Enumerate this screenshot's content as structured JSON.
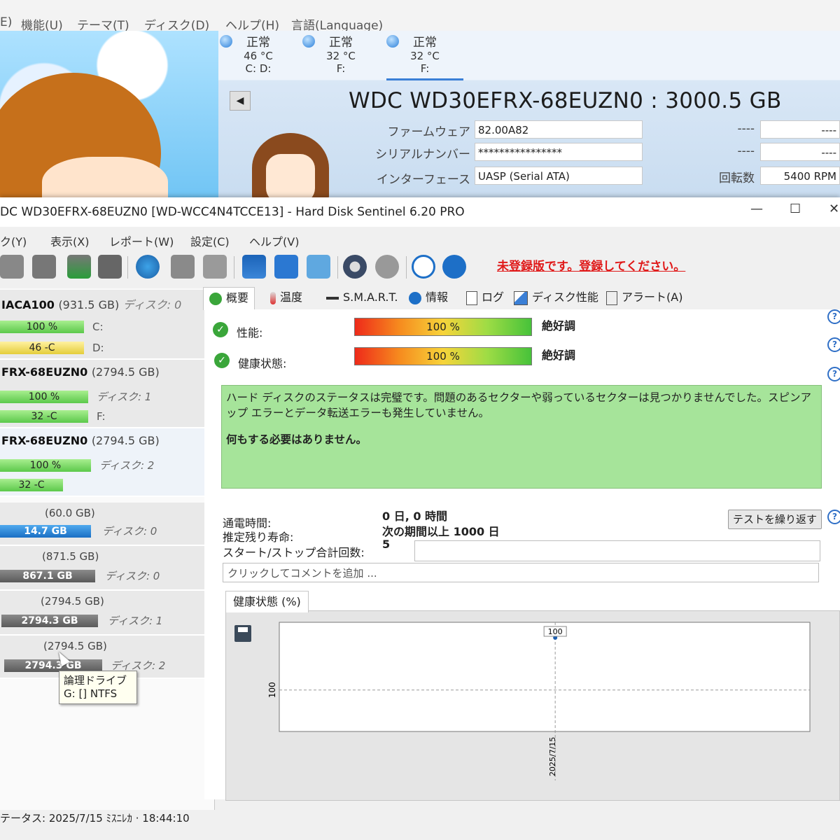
{
  "crystaldiskinfo": {
    "menu": [
      "E)",
      "機能(U)",
      "テーマ(T)",
      "ディスク(D)",
      "ヘルプ(H)",
      "言語(Language)"
    ],
    "disks": [
      {
        "status": "正常",
        "temp": "46 °C",
        "letters": "C: D:"
      },
      {
        "status": "正常",
        "temp": "32 °C",
        "letters": "F:"
      },
      {
        "status": "正常",
        "temp": "32 °C",
        "letters": "F:"
      }
    ],
    "prev_symbol": "◀",
    "title": "WDC WD30EFRX-68EUZN0 : 3000.5 GB",
    "fields": [
      {
        "label": "ファームウェア",
        "value": "82.00A82"
      },
      {
        "label": "シリアルナンバー",
        "value": "****************"
      },
      {
        "label": "インターフェース",
        "value": "UASP (Serial ATA)"
      }
    ],
    "right_fields": [
      {
        "label": "----",
        "value": "----"
      },
      {
        "label": "----",
        "value": "----"
      },
      {
        "label": "回転数",
        "value": "5400 RPM"
      }
    ]
  },
  "hds": {
    "title": "DC WD30EFRX-68EUZN0 [WD-WCC4N4TCCE13]  -  Hard Disk Sentinel 6.20 PRO",
    "window_buttons": {
      "minimize": "—",
      "maximize": "☐",
      "close": "✕"
    },
    "menu": [
      "ク(Y)",
      "表示(X)",
      "レポート(W)",
      "設定(C)",
      "ヘルプ(V)"
    ],
    "register_link": "未登録版です。登録してください。",
    "disk_list": [
      {
        "name": "IACA100",
        "size": "(931.5 GB)",
        "disk_no": "ディスク: 0",
        "bars": [
          {
            "text": "100 %",
            "color": "green",
            "letter": "C:"
          },
          {
            "text": "46 -C",
            "color": "yellow",
            "letter": "D:"
          }
        ]
      },
      {
        "name": "FRX-68EUZN0",
        "size": "(2794.5 GB)",
        "disk_no": "ディスク: 1",
        "bars": [
          {
            "text": "100 %",
            "color": "green",
            "letter": ""
          },
          {
            "text": "32 -C",
            "color": "green",
            "letter": "F:"
          }
        ]
      },
      {
        "name": "FRX-68EUZN0",
        "size": "(2794.5 GB)",
        "disk_no": "ディスク: 2",
        "bars": [
          {
            "text": "100 %",
            "color": "green",
            "letter": ""
          },
          {
            "text": "32 -C",
            "color": "green",
            "letter": ""
          }
        ]
      }
    ],
    "volumes": [
      {
        "size": "(60.0 GB)",
        "free": "14.7 GB",
        "color": "blue",
        "disk": "ディスク: 0"
      },
      {
        "size": "(871.5 GB)",
        "free": "867.1 GB",
        "color": "gray",
        "disk": "ディスク: 0"
      },
      {
        "size": "(2794.5 GB)",
        "free": "2794.3 GB",
        "color": "gray",
        "disk": "ディスク: 1"
      },
      {
        "size": "(2794.5 GB)",
        "free": "2794.3 GB",
        "color": "gray",
        "disk": "ディスク: 2"
      }
    ],
    "tooltip": {
      "line1": "論理ドライブ",
      "line2": "G: [] NTFS"
    },
    "tabs": [
      "概要",
      "温度",
      "S.M.A.R.T.",
      "情報",
      "ログ",
      "ディスク性能",
      "アラート(A)"
    ],
    "performance": {
      "label": "性能:",
      "value_text": "100 %",
      "value": 100,
      "rating": "絶好調"
    },
    "health": {
      "label": "健康状態:",
      "value_text": "100 %",
      "value": 100,
      "rating": "絶好調"
    },
    "status_message": "ハード ディスクのステータスは完璧です。問題のあるセクターや弱っているセクターは見つかりませんでした。スピンアップ エラーとデータ転送エラーも発生していません。",
    "status_action": "何もする必要はありません。",
    "info": [
      {
        "label": "通電時間:",
        "value": "0 日, 0 時間"
      },
      {
        "label": "推定残り寿命:",
        "value": "次の期間以上 1000 日"
      },
      {
        "label": "スタート/ストップ合計回数:",
        "value": "5"
      }
    ],
    "repeat_test_button": "テストを繰り返す",
    "comment_placeholder": "クリックしてコメントを追加 ...",
    "chart_tab": "健康状態 (%)",
    "statusbar": "テータス: 2025/7/15 ﾐｽﾆﾚｶ ·  18:44:10"
  },
  "chart_data": {
    "type": "line",
    "title": "健康状態 (%)",
    "x": [
      "2025/7/15"
    ],
    "series": [
      {
        "values": [
          100
        ]
      }
    ],
    "ytick_labels": [
      "100"
    ],
    "data_labels": [
      "100"
    ]
  },
  "colors": {
    "ok_green": "#3aa63a",
    "status_bg": "#a6e49a",
    "register_red": "#e01a1a"
  }
}
